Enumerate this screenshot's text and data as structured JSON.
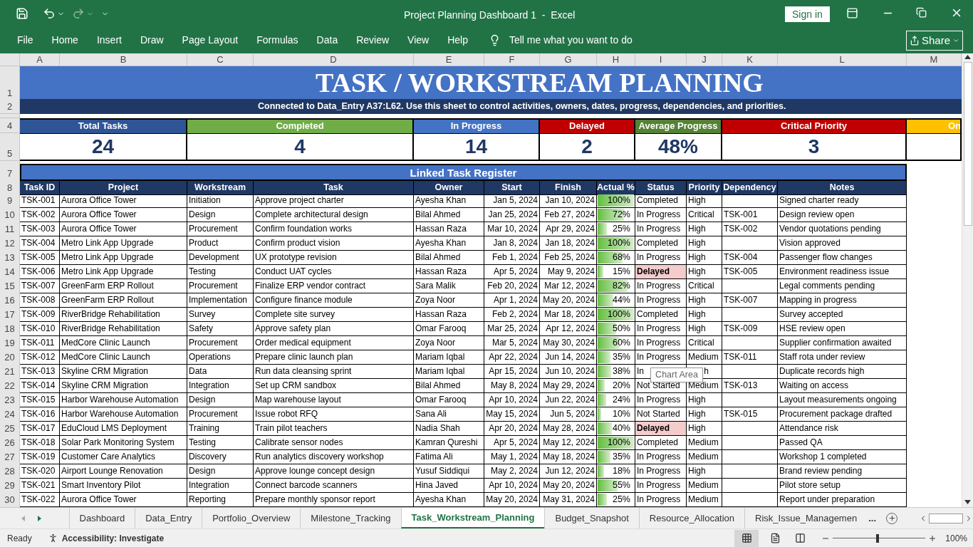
{
  "window": {
    "title": "Project Planning Dashboard 1  -  Excel",
    "sign_in": "Sign in"
  },
  "ribbon": {
    "tabs": [
      "File",
      "Home",
      "Insert",
      "Draw",
      "Page Layout",
      "Formulas",
      "Data",
      "Review",
      "View",
      "Help"
    ],
    "tell_me": "Tell me what you want to do",
    "share": "Share"
  },
  "column_headers": [
    "A",
    "B",
    "C",
    "D",
    "E",
    "F",
    "G",
    "H",
    "I",
    "J",
    "K",
    "L",
    "M"
  ],
  "sheet": {
    "title": "TASK / WORKSTREAM PLANNING",
    "subtitle": "Connected to Data_Entry A37:L62. Use this sheet to control activities, owners, dates, progress, dependencies, and priorities.",
    "kpis": [
      {
        "label": "Total Tasks",
        "value": "24",
        "color": "#2f5597"
      },
      {
        "label": "Completed",
        "value": "4",
        "color": "#70ad47"
      },
      {
        "label": "In Progress",
        "value": "14",
        "color": "#4472c4"
      },
      {
        "label": "Delayed",
        "value": "2",
        "color": "#c00000"
      },
      {
        "label": "Average Progress",
        "value": "48%",
        "color": "#548235"
      },
      {
        "label": "Critical Priority",
        "value": "3",
        "color": "#c00000"
      },
      {
        "label": "On",
        "color": "#ffc000"
      }
    ],
    "register_title": "Linked Task Register",
    "columns": [
      "Task ID",
      "Project",
      "Workstream",
      "Task",
      "Owner",
      "Start",
      "Finish",
      "Actual %",
      "Status",
      "Priority",
      "Dependency",
      "Notes"
    ],
    "rows": [
      {
        "row": "9",
        "id": "TSK-001",
        "project": "Aurora Office Tower",
        "workstream": "Initiation",
        "task": "Approve project charter",
        "owner": "Ayesha Khan",
        "start": "Jan 5, 2024",
        "finish": "Jan 10, 2024",
        "actual": "100%",
        "level": 1,
        "status": "Completed",
        "delayed": false,
        "priority": "High",
        "notes": "Signed charter ready"
      },
      {
        "row": "10",
        "id": "TSK-002",
        "project": "Aurora Office Tower",
        "workstream": "Design",
        "task": "Complete architectural design",
        "owner": "Bilal Ahmed",
        "start": "Jan 25, 2024",
        "finish": "Feb 27, 2024",
        "actual": "72%",
        "level": 0.72,
        "status": "In Progress",
        "delayed": false,
        "priority": "Critical",
        "dependency": "TSK-001",
        "notes": "Design review open"
      },
      {
        "row": "11",
        "id": "TSK-003",
        "project": "Aurora Office Tower",
        "workstream": "Procurement",
        "task": "Confirm foundation works",
        "owner": "Hassan Raza",
        "start": "Mar 10, 2024",
        "finish": "Apr 29, 2024",
        "actual": "25%",
        "level": 0.25,
        "status": "In Progress",
        "delayed": false,
        "priority": "High",
        "dependency": "TSK-002",
        "notes": "Vendor quotations pending"
      },
      {
        "row": "12",
        "id": "TSK-004",
        "project": "Metro Link App Upgrade",
        "workstream": "Product",
        "task": "Confirm product vision",
        "owner": "Ayesha Khan",
        "start": "Jan 8, 2024",
        "finish": "Jan 18, 2024",
        "actual": "100%",
        "level": 1,
        "status": "Completed",
        "delayed": false,
        "priority": "High",
        "notes": "Vision approved"
      },
      {
        "row": "13",
        "id": "TSK-005",
        "project": "Metro Link App Upgrade",
        "workstream": "Development",
        "task": "UX prototype revision",
        "owner": "Bilal Ahmed",
        "start": "Feb 1, 2024",
        "finish": "Feb 25, 2024",
        "actual": "68%",
        "level": 0.68,
        "status": "In Progress",
        "delayed": false,
        "priority": "High",
        "dependency": "TSK-004",
        "notes": "Passenger flow changes"
      },
      {
        "row": "14",
        "id": "TSK-006",
        "project": "Metro Link App Upgrade",
        "workstream": "Testing",
        "task": "Conduct UAT cycles",
        "owner": "Hassan Raza",
        "start": "Apr 5, 2024",
        "finish": "May 9, 2024",
        "actual": "15%",
        "level": 0.15,
        "status": "Delayed",
        "delayed": true,
        "priority": "High",
        "dependency": "TSK-005",
        "notes": "Environment readiness issue"
      },
      {
        "row": "15",
        "id": "TSK-007",
        "project": "GreenFarm ERP Rollout",
        "workstream": "Procurement",
        "task": "Finalize ERP vendor contract",
        "owner": "Sara Malik",
        "start": "Feb 20, 2024",
        "finish": "Mar 12, 2024",
        "actual": "82%",
        "level": 0.82,
        "status": "In Progress",
        "delayed": false,
        "priority": "Critical",
        "notes": "Legal comments pending"
      },
      {
        "row": "16",
        "id": "TSK-008",
        "project": "GreenFarm ERP Rollout",
        "workstream": "Implementation",
        "task": "Configure finance module",
        "owner": "Zoya Noor",
        "start": "Apr 1, 2024",
        "finish": "May 20, 2024",
        "actual": "44%",
        "level": 0.44,
        "status": "In Progress",
        "delayed": false,
        "priority": "High",
        "dependency": "TSK-007",
        "notes": "Mapping in progress"
      },
      {
        "row": "17",
        "id": "TSK-009",
        "project": "RiverBridge Rehabilitation",
        "workstream": "Survey",
        "task": "Complete site survey",
        "owner": "Hassan Raza",
        "start": "Feb 2, 2024",
        "finish": "Mar 18, 2024",
        "actual": "100%",
        "level": 1,
        "status": "Completed",
        "delayed": false,
        "priority": "High",
        "notes": "Survey accepted"
      },
      {
        "row": "18",
        "id": "TSK-010",
        "project": "RiverBridge Rehabilitation",
        "workstream": "Safety",
        "task": "Approve safety plan",
        "owner": "Omar Farooq",
        "start": "Mar 25, 2024",
        "finish": "Apr 12, 2024",
        "actual": "50%",
        "level": 0.5,
        "status": "In Progress",
        "delayed": false,
        "priority": "High",
        "dependency": "TSK-009",
        "notes": "HSE review open"
      },
      {
        "row": "19",
        "id": "TSK-011",
        "project": "MedCore Clinic Launch",
        "workstream": "Procurement",
        "task": "Order medical equipment",
        "owner": "Zoya Noor",
        "start": "Mar 5, 2024",
        "finish": "May 30, 2024",
        "actual": "60%",
        "level": 0.6,
        "status": "In Progress",
        "delayed": false,
        "priority": "Critical",
        "notes": "Supplier confirmation awaited"
      },
      {
        "row": "20",
        "id": "TSK-012",
        "project": "MedCore Clinic Launch",
        "workstream": "Operations",
        "task": "Prepare clinic launch plan",
        "owner": "Mariam Iqbal",
        "start": "Apr 22, 2024",
        "finish": "Jun 14, 2024",
        "actual": "35%",
        "level": 0.35,
        "status": "In Progress",
        "delayed": false,
        "priority": "Medium",
        "dependency": "TSK-011",
        "notes": "Staff rota under review"
      },
      {
        "row": "21",
        "id": "TSK-013",
        "project": "Skyline CRM Migration",
        "workstream": "Data",
        "task": "Run data cleansing sprint",
        "owner": "Mariam Iqbal",
        "start": "Apr 15, 2024",
        "finish": "Jun 10, 2024",
        "actual": "38%",
        "level": 0.38,
        "status": "In",
        "delayed": false,
        "priority": "h",
        "tooltip": "Chart Area",
        "notes": "Duplicate records high"
      },
      {
        "row": "22",
        "id": "TSK-014",
        "project": "Skyline CRM Migration",
        "workstream": "Integration",
        "task": "Set up CRM sandbox",
        "owner": "Bilal Ahmed",
        "start": "May 8, 2024",
        "finish": "May 29, 2024",
        "actual": "20%",
        "level": 0.2,
        "status": "Not Started",
        "delayed": false,
        "priority": "Medium",
        "dependency": "TSK-013",
        "notes": "Waiting on access"
      },
      {
        "row": "23",
        "id": "TSK-015",
        "project": "Harbor Warehouse Automation",
        "workstream": "Design",
        "task": "Map warehouse layout",
        "owner": "Omar Farooq",
        "start": "Apr 10, 2024",
        "finish": "Jun 22, 2024",
        "actual": "24%",
        "level": 0.24,
        "status": "In Progress",
        "delayed": false,
        "priority": "High",
        "notes": "Layout measurements ongoing"
      },
      {
        "row": "24",
        "id": "TSK-016",
        "project": "Harbor Warehouse Automation",
        "workstream": "Procurement",
        "task": "Issue robot RFQ",
        "owner": "Sana Ali",
        "start": "May 15, 2024",
        "finish": "Jun 5, 2024",
        "actual": "10%",
        "level": 0.1,
        "status": "Not Started",
        "delayed": false,
        "priority": "High",
        "dependency": "TSK-015",
        "notes": "Procurement package drafted"
      },
      {
        "row": "25",
        "id": "TSK-017",
        "project": "EduCloud LMS Deployment",
        "workstream": "Training",
        "task": "Train pilot teachers",
        "owner": "Nadia Shah",
        "start": "Apr 20, 2024",
        "finish": "May 28, 2024",
        "actual": "40%",
        "level": 0.4,
        "status": "Delayed",
        "delayed": true,
        "priority": "High",
        "notes": "Attendance risk"
      },
      {
        "row": "26",
        "id": "TSK-018",
        "project": "Solar Park Monitoring System",
        "workstream": "Testing",
        "task": "Calibrate sensor nodes",
        "owner": "Kamran Qureshi",
        "start": "Apr 5, 2024",
        "finish": "May 12, 2024",
        "actual": "100%",
        "level": 1,
        "status": "Completed",
        "delayed": false,
        "priority": "Medium",
        "notes": "Passed QA"
      },
      {
        "row": "27",
        "id": "TSK-019",
        "project": "Customer Care Analytics",
        "workstream": "Discovery",
        "task": "Run analytics discovery workshop",
        "owner": "Fatima Ali",
        "start": "May 1, 2024",
        "finish": "May 18, 2024",
        "actual": "35%",
        "level": 0.35,
        "status": "In Progress",
        "delayed": false,
        "priority": "Medium",
        "notes": "Workshop 1 completed"
      },
      {
        "row": "28",
        "id": "TSK-020",
        "project": "Airport Lounge Renovation",
        "workstream": "Design",
        "task": "Approve lounge concept design",
        "owner": "Yusuf Siddiqui",
        "start": "May 2, 2024",
        "finish": "Jun 12, 2024",
        "actual": "18%",
        "level": 0.18,
        "status": "In Progress",
        "delayed": false,
        "priority": "High",
        "notes": "Brand review pending"
      },
      {
        "row": "29",
        "id": "TSK-021",
        "project": "Smart Inventory Pilot",
        "workstream": "Integration",
        "task": "Connect barcode scanners",
        "owner": "Hina Javed",
        "start": "Apr 10, 2024",
        "finish": "May 20, 2024",
        "actual": "55%",
        "level": 0.55,
        "status": "In Progress",
        "delayed": false,
        "priority": "Medium",
        "notes": "Pilot store setup"
      },
      {
        "row": "30",
        "id": "TSK-022",
        "project": "Aurora Office Tower",
        "workstream": "Reporting",
        "task": "Prepare monthly sponsor report",
        "owner": "Ayesha Khan",
        "start": "May 20, 2024",
        "finish": "May 31, 2024",
        "actual": "25%",
        "level": 0.25,
        "status": "In Progress",
        "delayed": false,
        "priority": "Medium",
        "notes": "Report under preparation"
      }
    ]
  },
  "row_numbers": {
    "title": "1",
    "subtitle": "2",
    "kpi_labels": "4",
    "kpi_values": "5",
    "register": "7",
    "columns": "8"
  },
  "sheet_tabs": [
    {
      "label": "Dashboard",
      "selected": false
    },
    {
      "label": "Data_Entry",
      "selected": false
    },
    {
      "label": "Portfolio_Overview",
      "selected": false
    },
    {
      "label": "Milestone_Tracking",
      "selected": false
    },
    {
      "label": "Task_Workstream_Planning",
      "selected": true
    },
    {
      "label": "Budget_Snapshot",
      "selected": false
    },
    {
      "label": "Resource_Allocation",
      "selected": false
    },
    {
      "label": "Risk_Issue_Managemen",
      "selected": false
    }
  ],
  "more_tabs": "...",
  "status_bar": {
    "ready": "Ready",
    "accessibility": "Accessibility: Investigate",
    "zoom": {
      "level": 0.47,
      "reading": "100%"
    }
  }
}
